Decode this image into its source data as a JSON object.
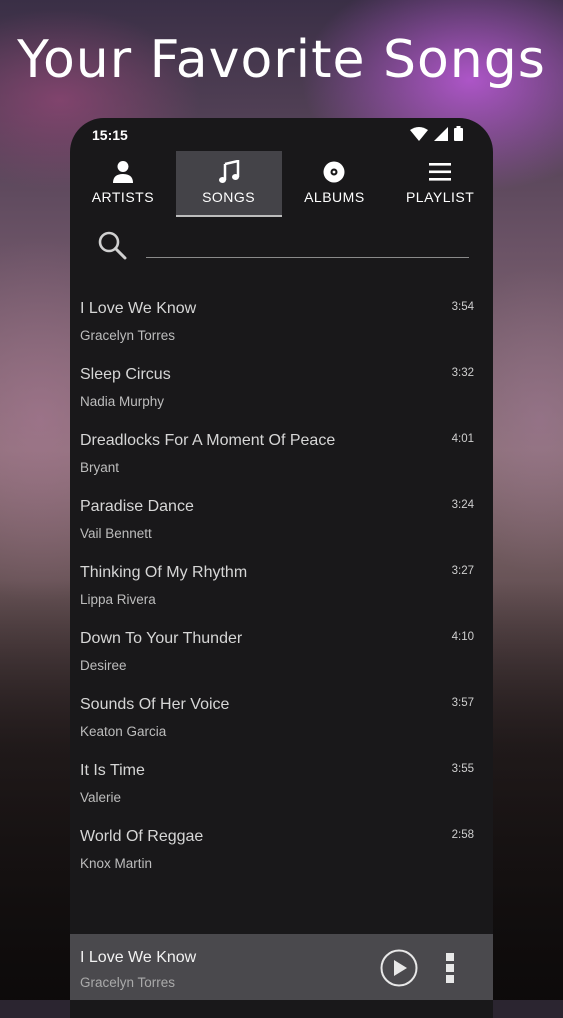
{
  "hero": {
    "title": "Your Favorite Songs"
  },
  "status_bar": {
    "time": "15:15"
  },
  "tabs": [
    {
      "label": "ARTISTS",
      "icon": "person-icon"
    },
    {
      "label": "SONGS",
      "icon": "music-note-icon",
      "active": true
    },
    {
      "label": "ALBUMS",
      "icon": "album-disc-icon"
    },
    {
      "label": "PLAYLIST",
      "icon": "playlist-icon"
    }
  ],
  "search": {
    "value": "",
    "placeholder": ""
  },
  "songs": [
    {
      "title": "I Love We Know",
      "artist": "Gracelyn Torres",
      "duration": "3:54"
    },
    {
      "title": "Sleep Circus",
      "artist": "Nadia Murphy",
      "duration": "3:32"
    },
    {
      "title": "Dreadlocks For A Moment Of Peace",
      "artist": "Bryant",
      "duration": "4:01"
    },
    {
      "title": "Paradise Dance",
      "artist": "Vail Bennett",
      "duration": "3:24"
    },
    {
      "title": "Thinking Of My Rhythm",
      "artist": "Lippa Rivera",
      "duration": "3:27"
    },
    {
      "title": "Down To Your Thunder",
      "artist": "Desiree",
      "duration": "4:10"
    },
    {
      "title": "Sounds Of Her Voice",
      "artist": "Keaton Garcia",
      "duration": "3:57"
    },
    {
      "title": "It Is Time",
      "artist": "Valerie",
      "duration": "3:55"
    },
    {
      "title": "World Of Reggae",
      "artist": "Knox Martin",
      "duration": "2:58"
    }
  ],
  "now_playing": {
    "title": "I Love We Know",
    "artist": "Gracelyn Torres"
  },
  "colors": {
    "panel": "#19181a",
    "active_tab": "#444348",
    "now_playing_bar": "#4a494d"
  }
}
